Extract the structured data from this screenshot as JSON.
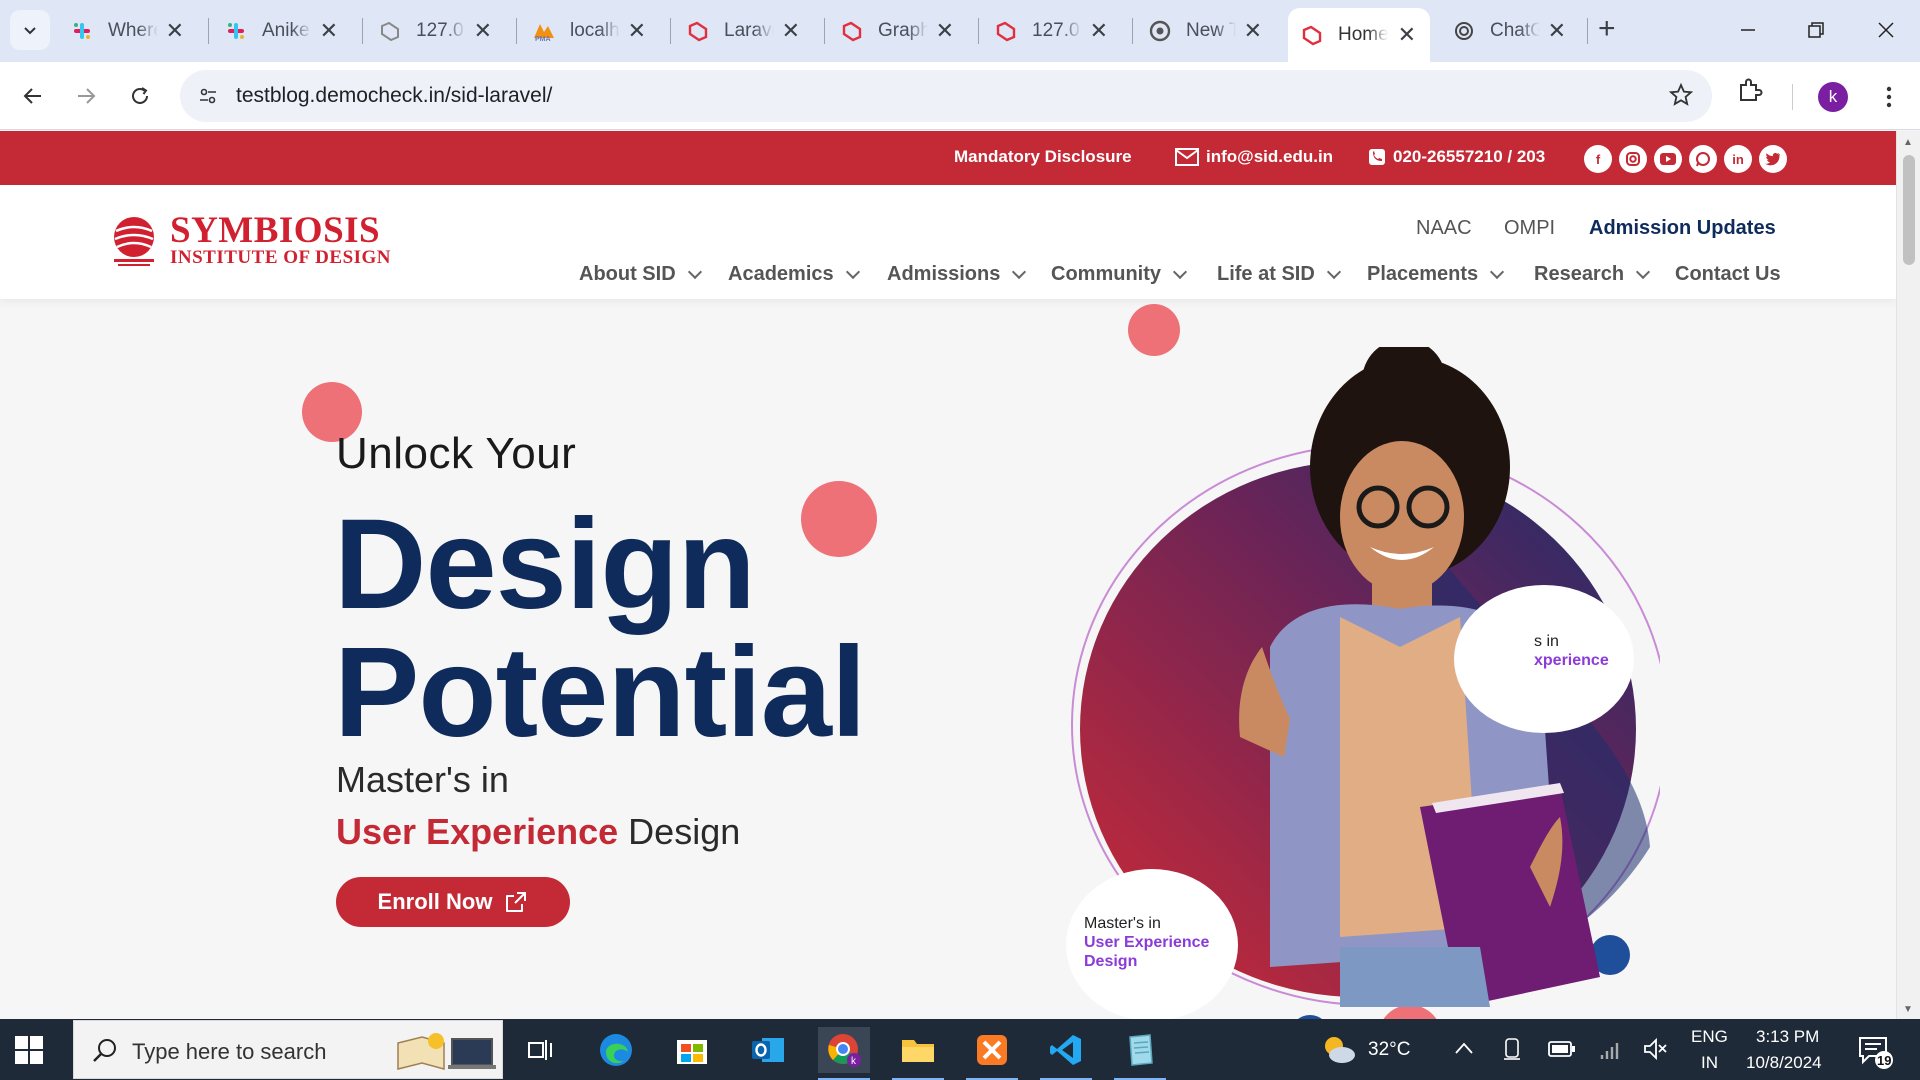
{
  "browser": {
    "tabs": [
      {
        "title": "Where",
        "favicon": "slack-icon"
      },
      {
        "title": "Anike",
        "favicon": "slack-icon"
      },
      {
        "title": "127.0.",
        "favicon": "laravel-grey-icon"
      },
      {
        "title": "localh",
        "favicon": "phpmyadmin-icon"
      },
      {
        "title": "Larave",
        "favicon": "laravel-icon"
      },
      {
        "title": "Graph",
        "favicon": "laravel-icon"
      },
      {
        "title": "127.0.",
        "favicon": "laravel-icon"
      },
      {
        "title": "New T",
        "favicon": "chrome-icon"
      },
      {
        "title": "Home",
        "favicon": "laravel-icon",
        "active": true
      },
      {
        "title": "ChatG",
        "favicon": "openai-icon"
      }
    ],
    "url": "testblog.democheck.in/sid-laravel/",
    "profile_initial": "k"
  },
  "site": {
    "topbar": {
      "disclosure": "Mandatory Disclosure",
      "email": "info@sid.edu.in",
      "phone": "020-26557210 / 203",
      "socials": [
        "facebook-icon",
        "instagram-icon",
        "youtube-icon",
        "whatsapp-icon",
        "linkedin-icon",
        "twitter-icon"
      ]
    },
    "logo": {
      "line1": "SYMBIOSIS",
      "line2": "INSTITUTE OF DESIGN"
    },
    "util_links": [
      "NAAC",
      "OMPI",
      "Admission Updates"
    ],
    "nav": [
      "About SID",
      "Academics",
      "Admissions",
      "Community",
      "Life at SID",
      "Placements",
      "Research",
      "Contact Us"
    ],
    "hero": {
      "line1": "Unlock Your",
      "big1": "Design",
      "big2": "Potential",
      "sub1": "Master's in",
      "sub_highlight": "User Experience",
      "sub_rest": " Design",
      "cta": "Enroll Now",
      "bubble_top_1": "s in",
      "bubble_top_2": "xperience",
      "bubble_1": "Master's in",
      "bubble_2": "User Experience",
      "bubble_3": "Design"
    },
    "colors": {
      "brand_red": "#c42a35",
      "navy": "#0f2b5b",
      "accent_purple": "#8b3bd8"
    }
  },
  "taskbar": {
    "search_placeholder": "Type here to search",
    "weather": "32°C",
    "lang1": "ENG",
    "lang2": "IN",
    "time": "3:13 PM",
    "date": "10/8/2024",
    "notifications": "19"
  }
}
